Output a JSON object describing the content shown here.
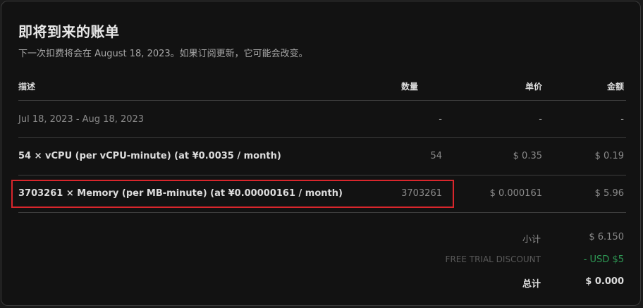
{
  "header": {
    "title": "即将到来的账单",
    "subtitle": "下一次扣费将会在 August 18, 2023。如果订阅更新，它可能会改变。"
  },
  "table": {
    "columns": {
      "description": "描述",
      "quantity": "数量",
      "unit_price": "单价",
      "amount": "金额"
    },
    "rows": [
      {
        "description": "Jul 18, 2023 - Aug 18, 2023",
        "quantity": "-",
        "unit_price": "-",
        "amount": "-"
      },
      {
        "description": "54 × vCPU (per vCPU-minute) (at ¥0.0035 / month)",
        "quantity": "54",
        "unit_price": "$ 0.35",
        "amount": "$ 0.19"
      },
      {
        "description": "3703261 × Memory (per MB-minute) (at ¥0.00000161 / month)",
        "quantity": "3703261",
        "unit_price": "$ 0.000161",
        "amount": "$ 5.96"
      }
    ]
  },
  "summary": {
    "subtotal_label": "小计",
    "subtotal_value": "$ 6.150",
    "discount_label": "FREE TRIAL DISCOUNT",
    "discount_value": "- USD $5",
    "total_label": "总计",
    "total_value": "$ 0.000"
  },
  "colors": {
    "background": "#121212",
    "highlight_border": "#d9262c",
    "discount_green": "#2e9a55"
  }
}
